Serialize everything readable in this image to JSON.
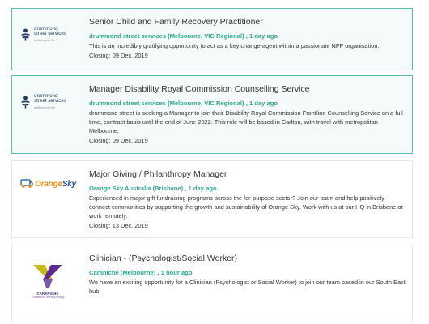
{
  "jobs": [
    {
      "title": "Senior Child and Family Recovery Practitioner",
      "company": "drummond street services (Melbourne, VIC Regional)",
      "posted": "1 day ago",
      "description": "This is an incredibly gratifying opportunity to act as a key change-agent within a passionate NFP organisation.",
      "closing": "Closing: 09 Dec, 2019",
      "logo": {
        "name_line1": "drummond",
        "name_line2": "street services",
        "tagline": "wellbeing for life",
        "color": "#1f3a5f"
      },
      "featured": true
    },
    {
      "title": "Manager Disability Royal Commission Counselling Service",
      "company": "drummond street services (Melbourne, VIC Regional)",
      "posted": "1 day ago",
      "description": "drummond street is seeking a Manager to join their Disability Royal Commission Frontline Counselling Service on a full-time, contract basis until the end of June 2022. This role will be based in Carlton, with travel with metropolitan Melbourne.",
      "closing": "Closing: 09 Dec, 2019",
      "logo": {
        "name_line1": "drummond",
        "name_line2": "street services",
        "tagline": "wellbeing for life",
        "color": "#1f3a5f"
      },
      "featured": true
    },
    {
      "title": "Major Giving / Philanthropy Manager",
      "company": "Orange Sky Australia (Brisbane)",
      "posted": "1 day ago",
      "description": "Experienced in major gift fundraising programs across the for-purpose sector? Join our team and help positively connect communities by supporting the growth and sustainability of Orange Sky. Work with us at our HQ in Brisbane or work remotely.",
      "closing": "Closing: 13 Dec, 2019",
      "logo": {
        "word_a": "Orange",
        "word_b": "Sky",
        "color_a": "#f7941d",
        "color_b": "#1e4f8c"
      },
      "featured": false
    },
    {
      "title": "Clinician - (Psychologist/Social Worker)",
      "company": "Caraniche (Melbourne)",
      "posted": "1 hour ago",
      "description": "We have an exciting opportunity for a Clinician (Psychologist or Social Worker) to join our team based in our South East hub",
      "closing": "",
      "logo": {
        "name": "CARANICHE",
        "tagline": "Excellence in Psychology",
        "color_a": "#c9b817",
        "color_b": "#5a2d8c"
      },
      "featured": false
    }
  ],
  "ui": {
    "meta_separator": ",",
    "accent_color": "#2ea58d",
    "featured_border_color": "#57c0b0"
  }
}
